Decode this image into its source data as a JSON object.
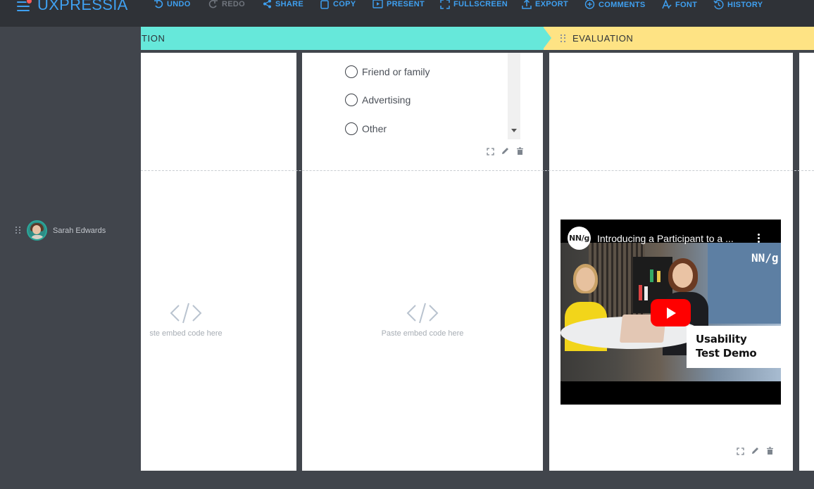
{
  "app": {
    "logo_text": "UXPRESSIA",
    "brand_color": "#3fa0f0"
  },
  "toolbar": {
    "items": [
      {
        "label": "UNDO",
        "icon": "undo-icon",
        "enabled": true
      },
      {
        "label": "REDO",
        "icon": "redo-icon",
        "enabled": false
      },
      {
        "label": "SHARE",
        "icon": "share-icon",
        "enabled": true
      },
      {
        "label": "COPY",
        "icon": "copy-icon",
        "enabled": true
      },
      {
        "label": "PRESENT",
        "icon": "present-icon",
        "enabled": true
      },
      {
        "label": "FULLSCREEN",
        "icon": "fullscreen-icon",
        "enabled": true
      },
      {
        "label": "EXPORT",
        "icon": "export-icon",
        "enabled": true
      },
      {
        "label": "COMMENTS",
        "icon": "comments-icon",
        "enabled": true
      },
      {
        "label": "FONT",
        "icon": "font-icon",
        "enabled": true
      },
      {
        "label": "HISTORY",
        "icon": "history-icon",
        "enabled": true
      }
    ]
  },
  "persona": {
    "name": "Sarah Edwards"
  },
  "stages": [
    {
      "label": "TION",
      "color": "#66e8da"
    },
    {
      "label": "EVALUATION",
      "color": "#fee384"
    }
  ],
  "survey": {
    "options": [
      "Friend or family",
      "Advertising",
      "Other"
    ]
  },
  "embed": {
    "placeholder_full": "Paste embed code here",
    "placeholder_cut": "ste embed code here"
  },
  "video": {
    "channel_badge": "NN/g",
    "title": "Introducing a Participant to a ...",
    "caption": "Usability Test Demo",
    "watermark": "NN/g"
  }
}
